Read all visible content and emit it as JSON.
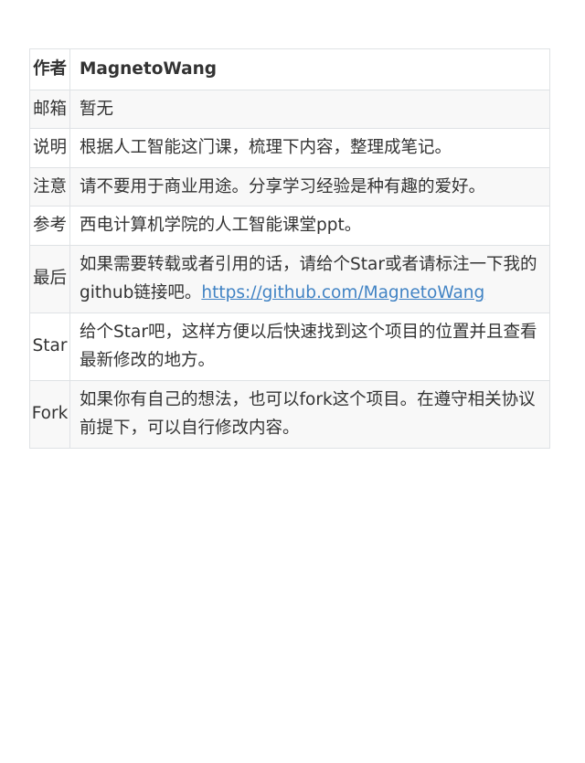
{
  "rows": [
    {
      "label": "作者",
      "value": "MagnetoWang"
    },
    {
      "label": "邮箱",
      "value": "暂无"
    },
    {
      "label": "说明",
      "value": "根据人工智能这门课，梳理下内容，整理成笔记。"
    },
    {
      "label": "注意",
      "value": "请不要用于商业用途。分享学习经验是种有趣的爱好。"
    },
    {
      "label": "参考",
      "value": " 西电计算机学院的人工智能课堂ppt。"
    },
    {
      "label": "最后",
      "value": "如果需要转载或者引用的话，请给个Star或者请标注一下我的github链接吧。",
      "link": "https://github.com/MagnetoWang"
    },
    {
      "label": "Star",
      "value": "给个Star吧，这样方便以后快速找到这个项目的位置并且查看最新修改的地方。"
    },
    {
      "label": "Fork",
      "value": "如果你有自己的想法，也可以fork这个项目。在遵守相关协议前提下，可以自行修改内容。"
    }
  ]
}
